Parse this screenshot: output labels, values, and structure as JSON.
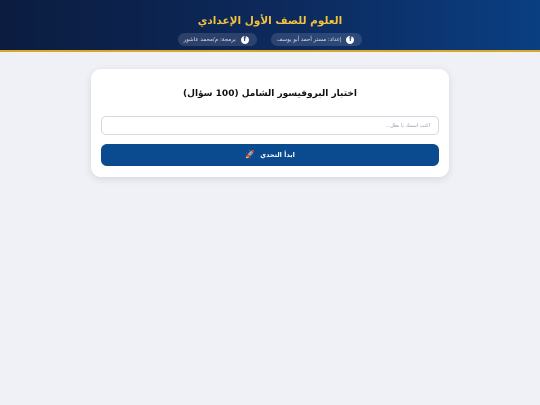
{
  "header": {
    "title": "العلوم للصف الأول الإعدادي",
    "credits": [
      {
        "label": "إعداد: مستر أحمد أبو يوسف",
        "icon": "facebook-icon"
      },
      {
        "label": "برمجة: م/محمد عاشور",
        "icon": "facebook-icon"
      }
    ]
  },
  "quiz": {
    "title": "اختبار البروفيسور الشامل (100 سؤال)",
    "name_placeholder": "اكتب اسمك يا بطل...",
    "start_label": "ابدأ التحدي",
    "start_icon": "rocket-icon"
  },
  "colors": {
    "header_gradient_start": "#0b1c3f",
    "header_gradient_end": "#0a3f82",
    "title_gold": "#f5c33b",
    "accent_border": "#d9a82b",
    "button_blue": "#0a4a8f",
    "page_background": "#eff1f6"
  }
}
